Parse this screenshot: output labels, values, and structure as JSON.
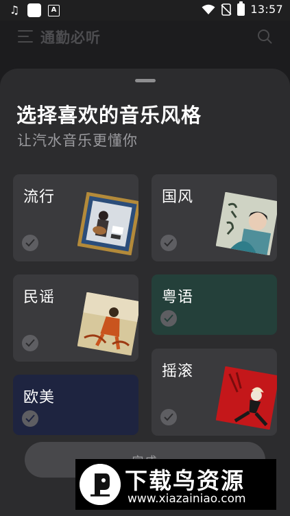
{
  "status_bar": {
    "time": "13:57",
    "left_icons": [
      "music-note-icon",
      "app-square-icon",
      "app-a-icon"
    ],
    "a_icon_text": "A",
    "right_icons": [
      "wifi-icon",
      "no-sim-icon",
      "battery-icon"
    ]
  },
  "top_bar": {
    "title": "通勤必听",
    "menu_icon": "menu-icon",
    "search_icon": "search-icon"
  },
  "sheet": {
    "title": "选择喜欢的音乐风格",
    "subtitle": "让汽水音乐更懂你"
  },
  "genres": [
    {
      "label": "流行",
      "has_art": true
    },
    {
      "label": "国风",
      "has_art": true
    },
    {
      "label": "民谣",
      "has_art": true
    },
    {
      "label": "粤语",
      "has_art": false
    },
    {
      "label": "欧美",
      "has_art": false
    },
    {
      "label": "摇滚",
      "has_art": true
    }
  ],
  "done_button": {
    "label": "完成"
  },
  "watermark": {
    "title": "下载鸟资源",
    "url": "www.xiazainiao.com"
  },
  "colors": {
    "background": "#1c1c1e",
    "sheet": "#2c2c2e",
    "card": "#3a3a3d",
    "yueyu_card": "#24403a",
    "oumei_card": "#1e2440",
    "check_circle": "#5e5e62"
  }
}
